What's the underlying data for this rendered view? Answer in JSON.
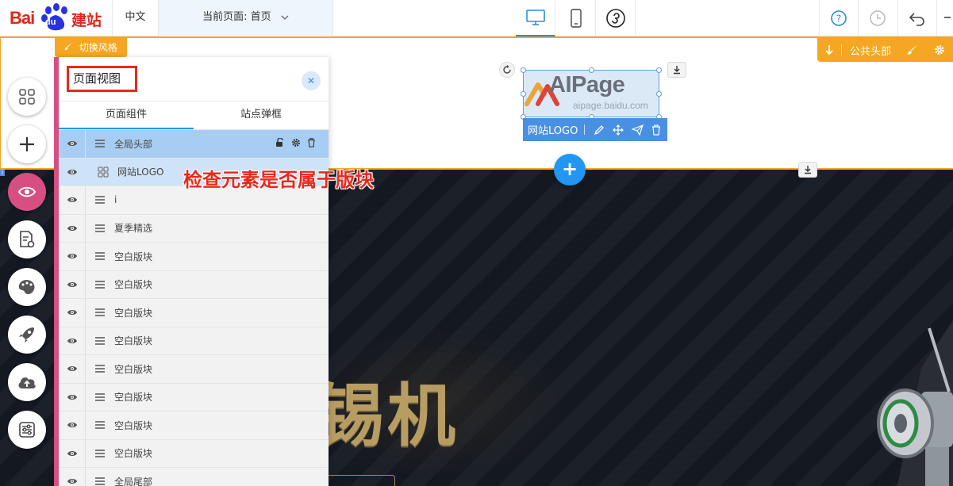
{
  "topbar": {
    "brand_bai": "Bai",
    "brand_du": "du",
    "brand_jianzhan": "建站",
    "language": "中文",
    "current_page": "当前页面: 首页"
  },
  "header_region": {
    "style_switch": "切换风格",
    "public_header": "公共头部",
    "logo_text": "AIPage",
    "logo_subtext": "aipage.baidu.com",
    "logo_toolbar_label": "网站LOGO"
  },
  "banner": {
    "title": "锡机"
  },
  "panel": {
    "title": "页面视图",
    "close": "✕",
    "tabs": [
      "页面组件",
      "站点弹框"
    ],
    "rows": [
      {
        "label": "全局头部",
        "state": "selected"
      },
      {
        "label": "网站LOGO",
        "state": "child"
      },
      {
        "label": "i",
        "state": "normal"
      },
      {
        "label": "夏季精选",
        "state": "normal"
      },
      {
        "label": "空白版块",
        "state": "normal"
      },
      {
        "label": "空白版块",
        "state": "normal"
      },
      {
        "label": "空白版块",
        "state": "normal"
      },
      {
        "label": "空白版块",
        "state": "normal"
      },
      {
        "label": "空白版块",
        "state": "normal"
      },
      {
        "label": "空白版块",
        "state": "normal"
      },
      {
        "label": "空白版块",
        "state": "normal"
      },
      {
        "label": "空白版块",
        "state": "normal"
      },
      {
        "label": "全局尾部",
        "state": "normal"
      }
    ]
  },
  "annotation": "检查元素是否属于版块",
  "left_toolbar": {
    "strip_label": "i"
  },
  "colors": {
    "accent_orange": "#f5a623",
    "accent_blue": "#2196f3",
    "annotation_red": "#e8291c",
    "panel_pink": "#d54f83"
  }
}
